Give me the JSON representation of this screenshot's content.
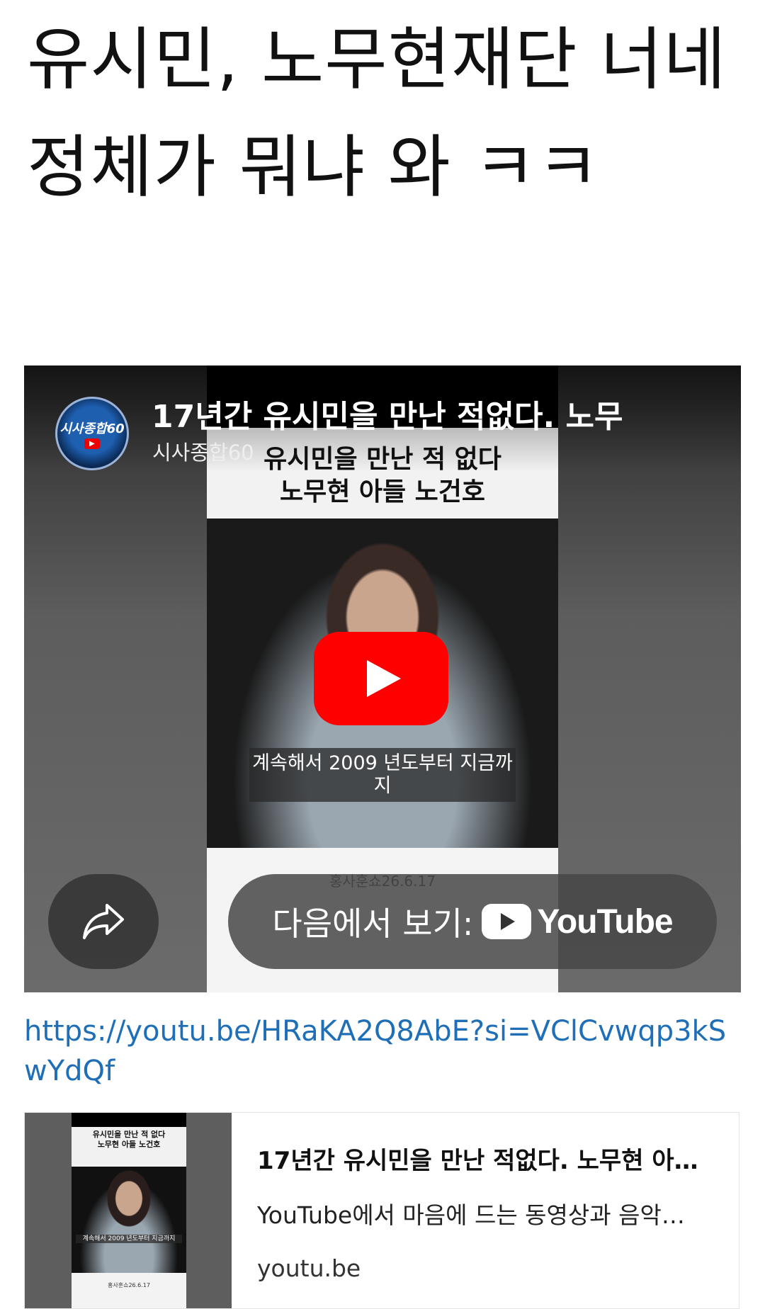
{
  "post": {
    "title": "유시민, 노무현재단 너네 정체가 뭐냐 와 ㅋㅋ"
  },
  "video": {
    "title": "17년간 유시민을 만난 적없다. 노무",
    "channel": "시사종합60",
    "channel_logo_text": "시사종합60",
    "caption_top": "유시민을 만난 적 없다\n노무현 아들 노건호",
    "subtitle": "계속해서 2009 년도부터 지금까지",
    "credit": "홍사훈쇼26.6.17",
    "watch_on_label": "다음에서 보기:",
    "youtube_wordmark": "YouTube",
    "play_icon": "play-icon",
    "share_icon": "share-arrow-icon",
    "accent": "#ff0000"
  },
  "link": {
    "url": "https://youtu.be/HRaKA2Q8AbE?si=VClCvwqp3kSwYdQf",
    "color": "#1f6fb8"
  },
  "card": {
    "title": "17년간 유시민을 만난 적없다. 노무현 아…",
    "description": "YouTube에서 마음에 드는 동영상과 음악…",
    "domain": "youtu.be",
    "thumb_caption": "유시민을 만난 적 없다\n노무현 아들 노건호",
    "thumb_subtitle": "계속해서 2009 년도부터 지금까지",
    "thumb_credit": "홍사훈쇼26.6.17"
  }
}
